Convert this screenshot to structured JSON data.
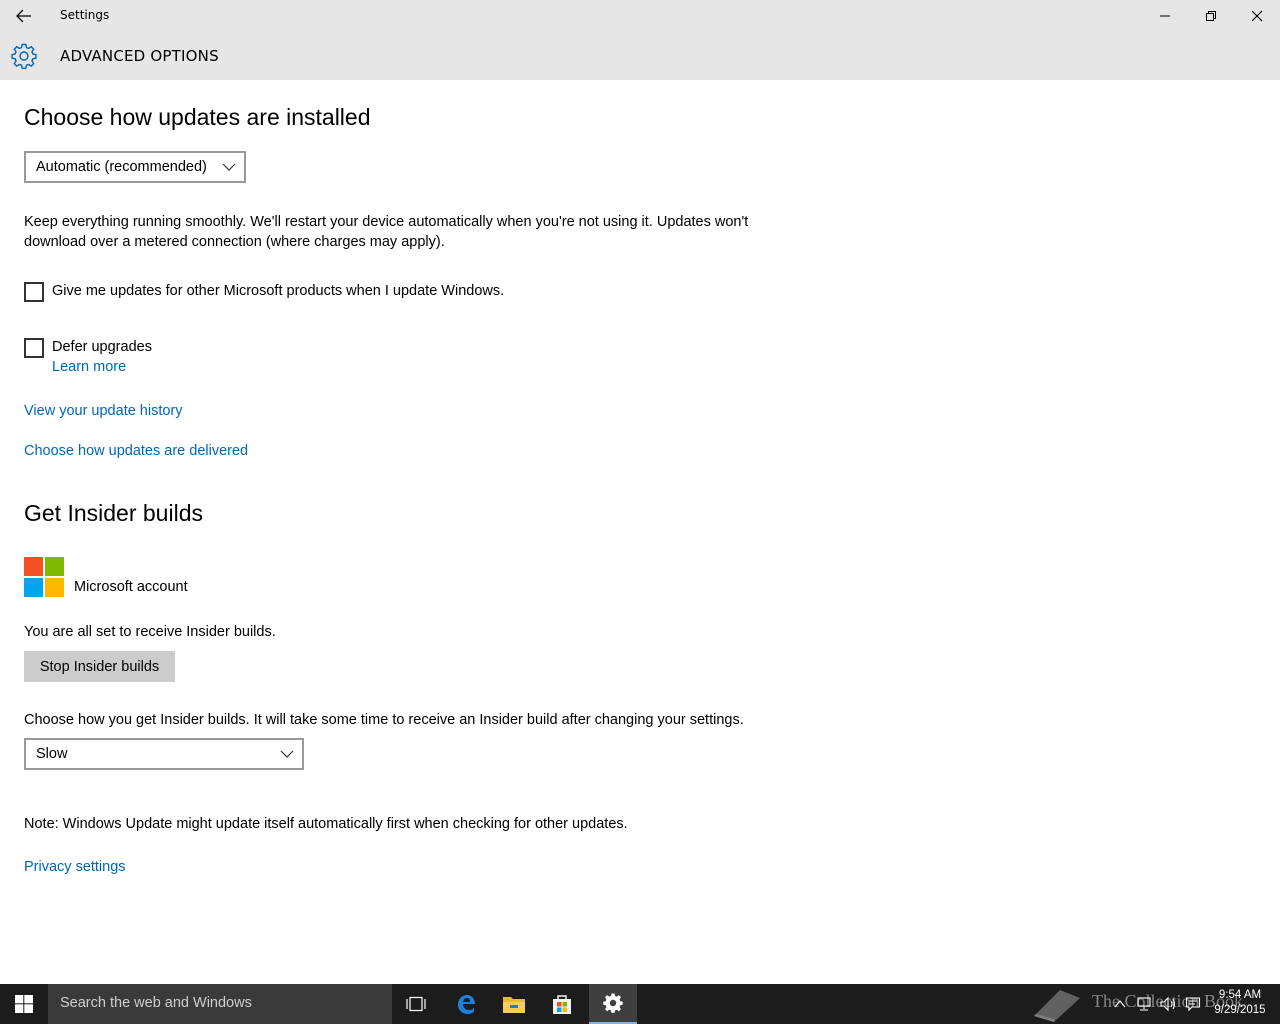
{
  "window": {
    "title": "Settings",
    "back_icon": "back-arrow-icon",
    "minimize_icon": "minimize-icon",
    "maximize_icon": "restore-icon",
    "close_icon": "close-icon"
  },
  "header": {
    "icon": "gear-icon",
    "title": "ADVANCED OPTIONS",
    "accent": "#0067b8"
  },
  "install": {
    "heading": "Choose how updates are installed",
    "dropdown_value": "Automatic (recommended)",
    "description_line1": "Keep everything running smoothly. We'll restart your device automatically when you're not using it. Updates won't",
    "description_line2": "download over a metered connection (where charges may apply).",
    "checkbox_other_products": "Give me updates for other Microsoft products when I update Windows.",
    "checkbox_other_products_checked": false,
    "checkbox_defer": "Defer upgrades",
    "checkbox_defer_checked": false,
    "learn_more": "Learn more",
    "link_history": "View your update history",
    "link_delivery": "Choose how updates are delivered"
  },
  "insider": {
    "heading": "Get Insider builds",
    "account_label": "Microsoft account",
    "status": "You are all set to receive Insider builds.",
    "stop_button": "Stop Insider builds",
    "choose_text": "Choose how you get Insider builds. It will take some time to receive an Insider build after changing your settings.",
    "ring_value": "Slow",
    "note": "Note: Windows Update might update itself automatically first when checking for other updates.",
    "privacy_link": "Privacy settings"
  },
  "taskbar": {
    "search_placeholder": "Search the web and Windows",
    "watermark": "The Collection Book",
    "time": "9:54 AM",
    "date": "9/29/2015",
    "apps": [
      "task-view-icon",
      "edge-icon",
      "file-explorer-icon",
      "store-icon",
      "settings-gear-icon"
    ],
    "tray": [
      "chevron-up-icon",
      "network-icon",
      "volume-icon",
      "action-center-icon"
    ]
  }
}
